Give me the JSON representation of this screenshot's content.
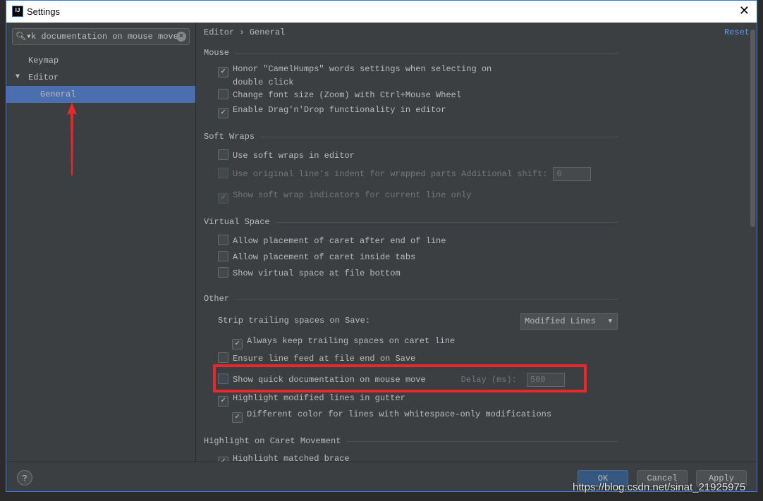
{
  "window": {
    "title": "Settings",
    "logo": "IJ"
  },
  "search": {
    "value": "k documentation on mouse move"
  },
  "tree": [
    {
      "label": "Keymap"
    },
    {
      "label": "Editor",
      "expanded": true
    },
    {
      "label": "General",
      "selected": true
    }
  ],
  "breadcrumb": {
    "parent": "Editor",
    "sep": "›",
    "current": "General"
  },
  "reset": "Reset",
  "sections": {
    "mouse": {
      "title": "Mouse",
      "items": [
        {
          "label": "Honor \"CamelHumps\" words settings when selecting on",
          "label2": "double click",
          "checked": true
        },
        {
          "label": "Change font size (Zoom) with Ctrl+Mouse Wheel",
          "checked": false
        },
        {
          "label": "Enable Drag'n'Drop functionality in editor",
          "checked": true
        }
      ]
    },
    "soft": {
      "title": "Soft Wraps",
      "items": [
        {
          "label": "Use soft wraps in editor",
          "checked": false
        },
        {
          "label": "Use original line's indent for wrapped parts",
          "checked": false,
          "extra_label": "Additional shift:",
          "extra_value": "0"
        },
        {
          "label": "Show soft wrap indicators for current line only",
          "checked": true
        }
      ]
    },
    "virtual": {
      "title": "Virtual Space",
      "items": [
        {
          "label": "Allow placement of caret after end of line",
          "checked": false
        },
        {
          "label": "Allow placement of caret inside tabs",
          "checked": false
        },
        {
          "label": "Show virtual space at file bottom",
          "checked": false
        }
      ]
    },
    "other": {
      "title": "Other",
      "strip_label": "Strip trailing spaces on Save:",
      "strip_value": "Modified Lines",
      "items": [
        {
          "label": "Always keep trailing spaces on caret line",
          "checked": true
        },
        {
          "label": "Ensure line feed at file end on Save",
          "checked": false
        },
        {
          "label": "Show quick documentation on mouse move",
          "checked": false,
          "extra_label": "Delay (ms):",
          "extra_value": "500"
        },
        {
          "label": "Highlight modified lines in gutter",
          "checked": true
        },
        {
          "label": "Different color for lines with whitespace-only modifications",
          "checked": true
        }
      ]
    },
    "caret": {
      "title": "Highlight on Caret Movement",
      "items": [
        {
          "label": "Highlight matched brace",
          "checked": true
        }
      ]
    }
  },
  "buttons": {
    "help": "?",
    "ok": "OK",
    "cancel": "Cancel",
    "apply": "Apply"
  },
  "watermark": "https://blog.csdn.net/sinat_21925975",
  "colors": {
    "accent": "#4b6eaf",
    "highlight_box": "#e8282b",
    "link": "#589df6"
  }
}
